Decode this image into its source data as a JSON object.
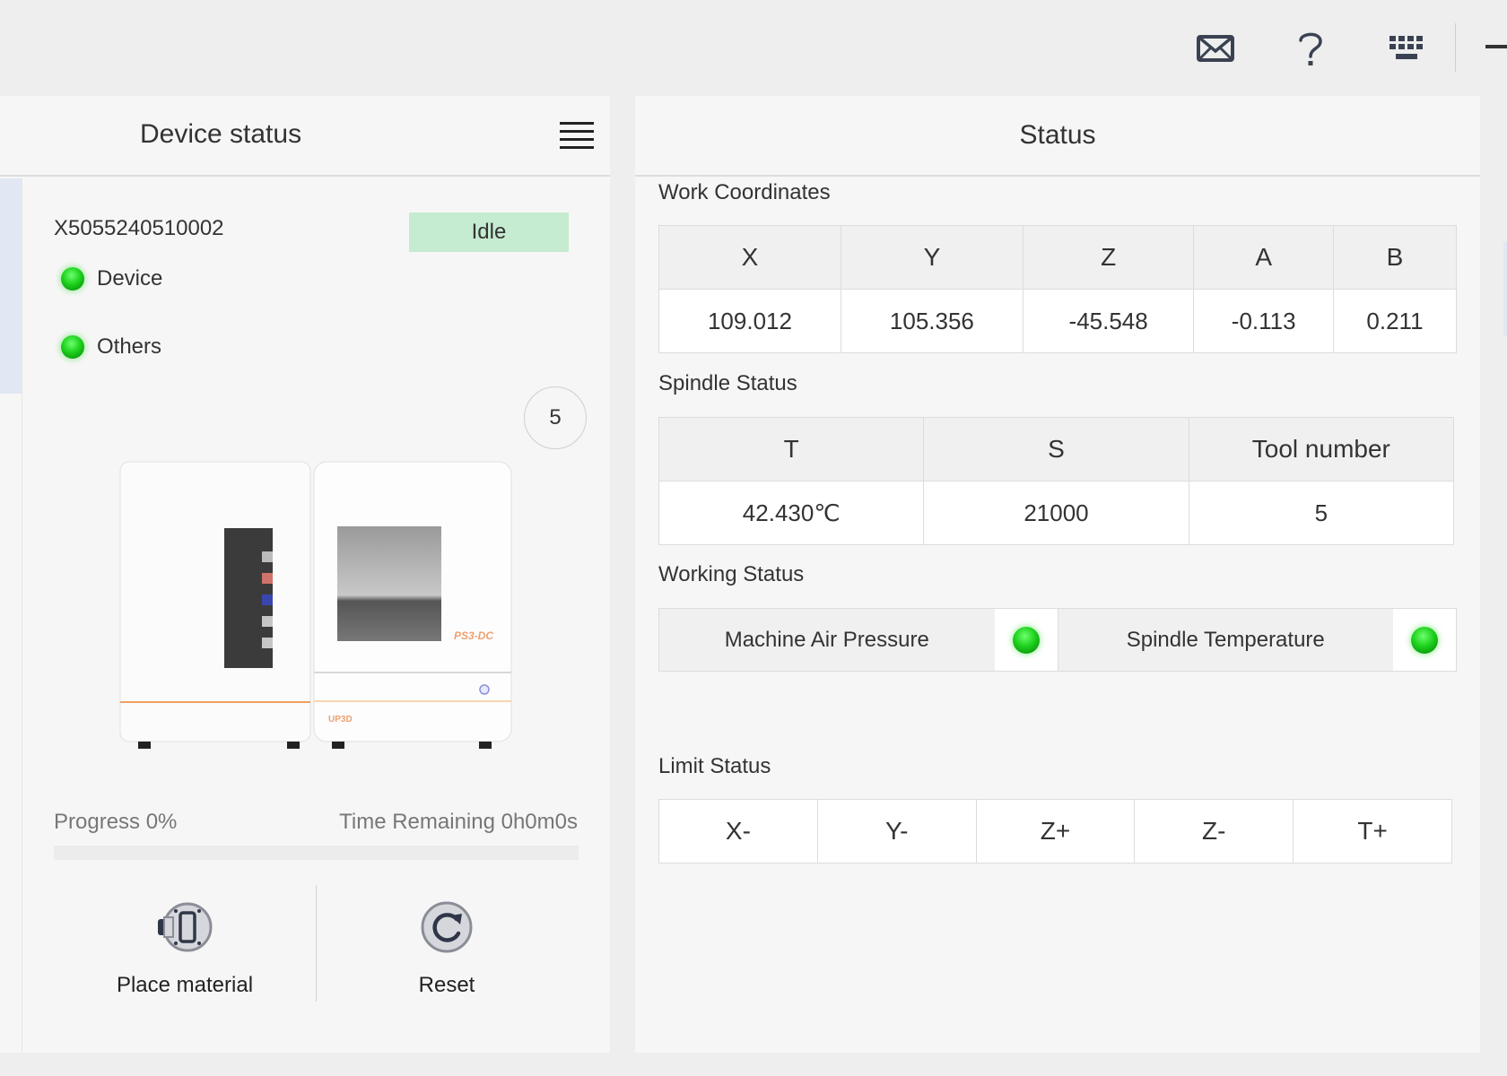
{
  "topbar": {
    "icons": [
      "mail-icon",
      "help-icon",
      "keyboard-icon",
      "minimize-icon"
    ]
  },
  "device_panel": {
    "title": "Device status",
    "serial": "X5055240510002",
    "status": "Idle",
    "status_color": "#c5ebd0",
    "indicators": [
      {
        "label": "Device",
        "state": "ok",
        "color": "#22cc22"
      },
      {
        "label": "Others",
        "state": "ok",
        "color": "#22cc22"
      }
    ],
    "tool_count": "5",
    "machine": {
      "model": "PS3-DC",
      "brand": "UP3D"
    },
    "progress_label": "Progress 0%",
    "progress_value": 0,
    "time_remaining": "Time Remaining 0h0m0s",
    "actions": [
      {
        "label": "Place material",
        "icon": "place-material-icon"
      },
      {
        "label": "Reset",
        "icon": "reset-icon"
      }
    ]
  },
  "status_panel": {
    "title": "Status",
    "work_coordinates": {
      "title": "Work Coordinates",
      "headers": [
        "X",
        "Y",
        "Z",
        "A",
        "B"
      ],
      "values": [
        "109.012",
        "105.356",
        "-45.548",
        "-0.113",
        "0.211"
      ]
    },
    "spindle_status": {
      "title": "Spindle Status",
      "headers": [
        "T",
        "S",
        "Tool number"
      ],
      "values": [
        "42.430℃",
        "21000",
        "5"
      ]
    },
    "working_status": {
      "title": "Working Status",
      "items": [
        {
          "label": "Machine Air Pressure",
          "state": "ok"
        },
        {
          "label": "Spindle Temperature",
          "state": "ok"
        }
      ]
    },
    "limit_status": {
      "title": "Limit Status",
      "items": [
        "X-",
        "Y-",
        "Z+",
        "Z-",
        "T+"
      ]
    }
  }
}
